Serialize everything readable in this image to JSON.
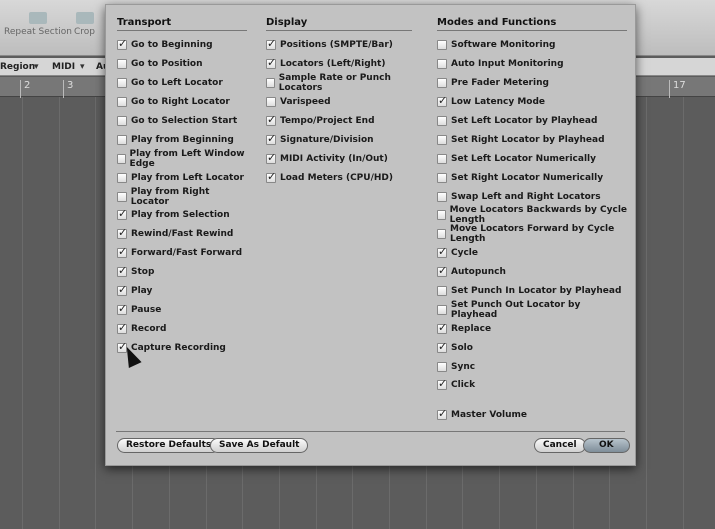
{
  "background": {
    "toolbar": [
      {
        "label": "Repeat Section",
        "icon": "repeat-section-icon"
      },
      {
        "label": "Crop",
        "icon": "crop-icon"
      }
    ],
    "menus": [
      "Region",
      "MIDI",
      "Au"
    ],
    "ruler": [
      "2",
      "3",
      "17"
    ]
  },
  "dialog": {
    "columns": [
      {
        "title": "Transport",
        "items": [
          {
            "label": "Go to Beginning",
            "checked": true
          },
          {
            "label": "Go to Position",
            "checked": false
          },
          {
            "label": "Go to Left Locator",
            "checked": false
          },
          {
            "label": "Go to Right Locator",
            "checked": false
          },
          {
            "label": "Go to Selection Start",
            "checked": false
          },
          {
            "label": "Play from Beginning",
            "checked": false
          },
          {
            "label": "Play from Left Window Edge",
            "checked": false
          },
          {
            "label": "Play from Left Locator",
            "checked": false
          },
          {
            "label": "Play from Right Locator",
            "checked": false
          },
          {
            "label": "Play from Selection",
            "checked": true
          },
          {
            "label": "Rewind/Fast Rewind",
            "checked": true
          },
          {
            "label": "Forward/Fast Forward",
            "checked": true
          },
          {
            "label": "Stop",
            "checked": true
          },
          {
            "label": "Play",
            "checked": true
          },
          {
            "label": "Pause",
            "checked": true
          },
          {
            "label": "Record",
            "checked": true
          },
          {
            "label": "Capture Recording",
            "checked": true
          }
        ]
      },
      {
        "title": "Display",
        "items": [
          {
            "label": "Positions (SMPTE/Bar)",
            "checked": true
          },
          {
            "label": "Locators (Left/Right)",
            "checked": true
          },
          {
            "label": "Sample Rate or Punch Locators",
            "checked": false
          },
          {
            "label": "Varispeed",
            "checked": false
          },
          {
            "label": "Tempo/Project End",
            "checked": true
          },
          {
            "label": "Signature/Division",
            "checked": true
          },
          {
            "label": "MIDI Activity (In/Out)",
            "checked": true
          },
          {
            "label": "Load Meters (CPU/HD)",
            "checked": true
          }
        ]
      },
      {
        "title": "Modes and Functions",
        "items": [
          {
            "label": "Software Monitoring",
            "checked": false
          },
          {
            "label": "Auto Input Monitoring",
            "checked": false
          },
          {
            "label": "Pre Fader Metering",
            "checked": false
          },
          {
            "label": "Low Latency Mode",
            "checked": true
          },
          {
            "label": "Set Left Locator by Playhead",
            "checked": false
          },
          {
            "label": "Set Right Locator by Playhead",
            "checked": false
          },
          {
            "label": "Set Left Locator Numerically",
            "checked": false
          },
          {
            "label": "Set Right Locator Numerically",
            "checked": false
          },
          {
            "label": "Swap Left and Right Locators",
            "checked": false
          },
          {
            "label": "Move Locators Backwards by Cycle Length",
            "checked": false
          },
          {
            "label": "Move Locators Forward by Cycle Length",
            "checked": false
          },
          {
            "label": "Cycle",
            "checked": true
          },
          {
            "label": "Autopunch",
            "checked": true
          },
          {
            "label": "Set Punch In Locator by Playhead",
            "checked": false
          },
          {
            "label": "Set Punch Out Locator by Playhead",
            "checked": false
          },
          {
            "label": "Replace",
            "checked": true
          },
          {
            "label": "Solo",
            "checked": true
          },
          {
            "label": "Sync",
            "checked": false
          },
          {
            "label": "Click",
            "checked": true
          }
        ]
      }
    ],
    "master_volume": {
      "label": "Master Volume",
      "checked": true
    },
    "buttons": {
      "restore": "Restore Defaults",
      "save": "Save As Default",
      "cancel": "Cancel",
      "ok": "OK"
    }
  }
}
